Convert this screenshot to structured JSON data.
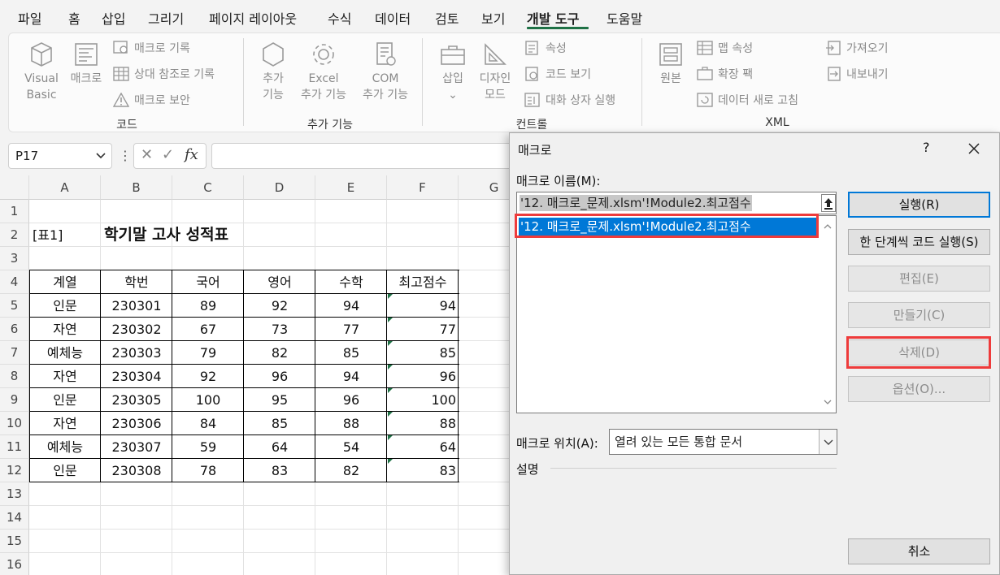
{
  "menu": {
    "tabs": [
      "파일",
      "홈",
      "삽입",
      "그리기",
      "페이지 레이아웃",
      "수식",
      "데이터",
      "검토",
      "보기",
      "개발 도구",
      "도움말"
    ],
    "active_index": 9
  },
  "ribbon": {
    "groups": {
      "code": "코드",
      "addins": "추가 기능",
      "controls": "컨트롤",
      "xml": "XML"
    },
    "buttons": {
      "visual_basic": [
        "Visual",
        "Basic"
      ],
      "macro": "매크로",
      "record_macro": "매크로 기록",
      "relative_ref": "상대 참조로 기록",
      "macro_security": "매크로 보안",
      "addins": [
        "추가",
        "기능"
      ],
      "excel_addins": [
        "Excel",
        "추가 기능"
      ],
      "com_addins": [
        "COM",
        "추가 기능"
      ],
      "insert": [
        "삽입",
        "⌄"
      ],
      "design_mode": [
        "디자인",
        "모드"
      ],
      "properties": "속성",
      "view_code": "코드 보기",
      "run_dialog": "대화 상자 실행",
      "source": "원본",
      "map_props": "맵 속성",
      "expansion_packs": "확장 팩",
      "refresh_data": "데이터 새로 고침",
      "import": "가져오기",
      "export": "내보내기"
    }
  },
  "formula_bar": {
    "name_box": "P17",
    "fx_label": "fx"
  },
  "sheet": {
    "columns": [
      "A",
      "B",
      "C",
      "D",
      "E",
      "F",
      "G"
    ],
    "rows": [
      "1",
      "2",
      "3",
      "4",
      "5",
      "6",
      "7",
      "8",
      "9",
      "10",
      "11",
      "12",
      "13",
      "14",
      "15",
      "16"
    ],
    "label_cell": "[표1]",
    "title": "학기말 고사 성적표",
    "headers": [
      "계열",
      "학번",
      "국어",
      "영어",
      "수학",
      "최고점수"
    ],
    "data": [
      [
        "인문",
        "230301",
        "89",
        "92",
        "94",
        "94"
      ],
      [
        "자연",
        "230302",
        "67",
        "73",
        "77",
        "77"
      ],
      [
        "예체능",
        "230303",
        "79",
        "82",
        "85",
        "85"
      ],
      [
        "자연",
        "230304",
        "92",
        "96",
        "94",
        "96"
      ],
      [
        "인문",
        "230305",
        "100",
        "95",
        "96",
        "100"
      ],
      [
        "자연",
        "230306",
        "84",
        "85",
        "88",
        "88"
      ],
      [
        "예체능",
        "230307",
        "59",
        "64",
        "54",
        "64"
      ],
      [
        "인문",
        "230308",
        "78",
        "83",
        "82",
        "83"
      ]
    ]
  },
  "dialog": {
    "title": "매크로",
    "help": "?",
    "name_label": "매크로 이름(M):",
    "name_value": "'12. 매크로_문제.xlsm'!Module2.최고점수",
    "list": [
      "'12. 매크로_문제.xlsm'!Module2.최고점수"
    ],
    "buttons": {
      "run": "실행(R)",
      "step_into": "한 단계씩 코드 실행(S)",
      "edit": "편집(E)",
      "create": "만들기(C)",
      "delete": "삭제(D)",
      "options": "옵션(O)..."
    },
    "location_label": "매크로 위치(A):",
    "location_value": "열려 있는 모든 통합 문서",
    "description_label": "설명",
    "cancel": "취소"
  },
  "colors": {
    "accent_green": "#1e7145",
    "selection_blue": "#0078d7",
    "highlight_red": "#ee3b3b"
  }
}
